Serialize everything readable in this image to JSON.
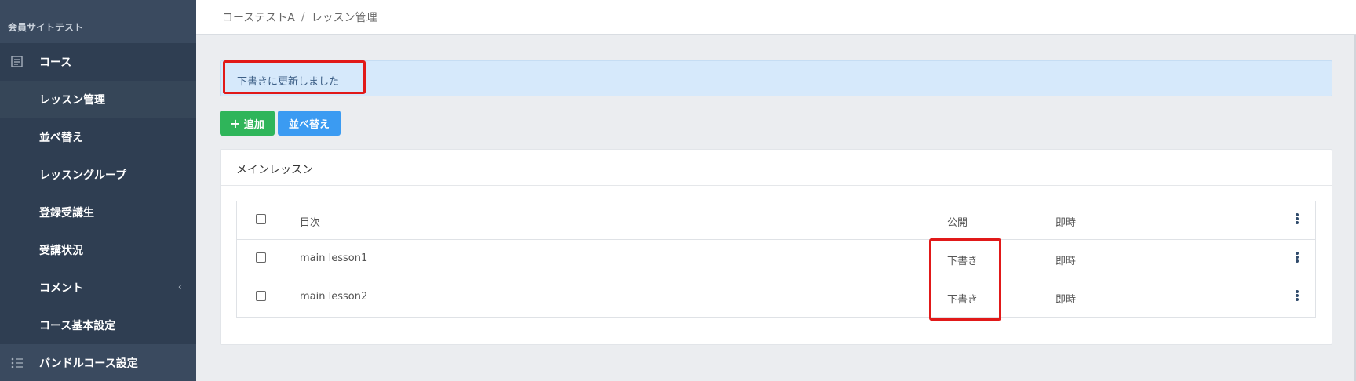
{
  "sidebar": {
    "brand": "会員サイトテスト",
    "items": [
      {
        "label": "コース",
        "icon": "document-icon"
      },
      {
        "label": "レッスン管理"
      },
      {
        "label": "並べ替え"
      },
      {
        "label": "レッスングループ"
      },
      {
        "label": "登録受講生"
      },
      {
        "label": "受講状況"
      },
      {
        "label": "コメント",
        "chevron": "‹"
      },
      {
        "label": "コース基本設定"
      },
      {
        "label": "バンドルコース設定",
        "icon": "list-icon"
      }
    ]
  },
  "header": {
    "breadcrumb": [
      "コーステストA",
      "レッスン管理"
    ],
    "separator": "/"
  },
  "alert": {
    "message": "下書きに更新しました"
  },
  "toolbar": {
    "add_label": "追加",
    "add_icon": "+",
    "sort_label": "並べ替え"
  },
  "card": {
    "title": "メインレッスン",
    "columns": {
      "title": "目次",
      "public": "公開",
      "instant": "即時"
    },
    "rows": [
      {
        "title": "main lesson1",
        "public": "下書き",
        "instant": "即時"
      },
      {
        "title": "main lesson2",
        "public": "下書き",
        "instant": "即時"
      }
    ]
  },
  "colors": {
    "sidebar_bg": "#2f3e52",
    "highlight": "#e11919",
    "add_button": "#2fb55a",
    "sort_button": "#3b9bf2",
    "alert_bg": "#d6e9fb"
  }
}
